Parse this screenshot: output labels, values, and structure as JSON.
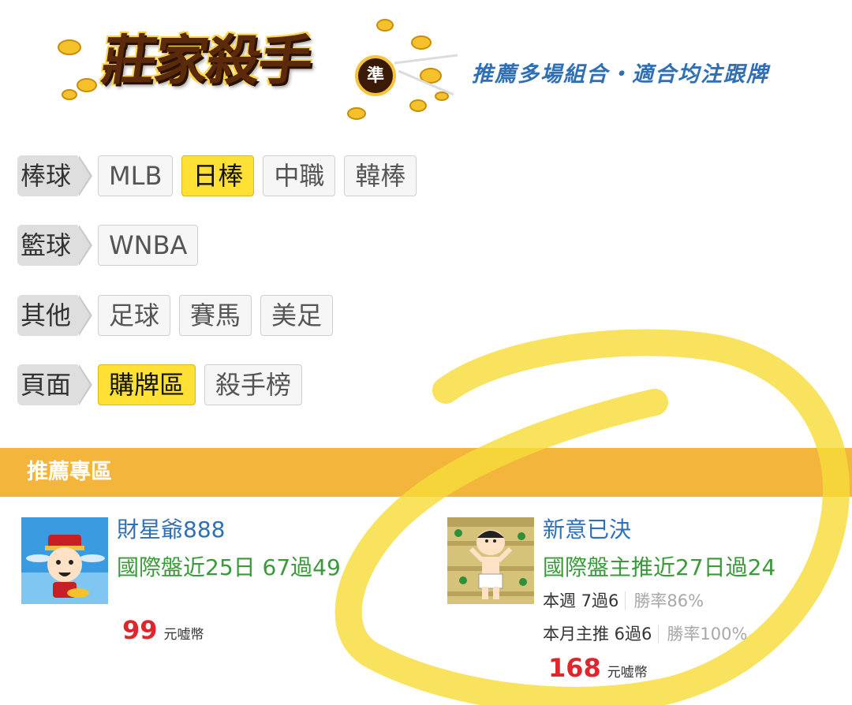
{
  "header": {
    "logo_text": "莊家殺手",
    "logo_badge": "準",
    "slogan": "推薦多場組合・適合均注跟牌"
  },
  "categories": [
    {
      "label": "棒球",
      "items": [
        {
          "label": "MLB",
          "active": false
        },
        {
          "label": "日棒",
          "active": true
        },
        {
          "label": "中職",
          "active": false
        },
        {
          "label": "韓棒",
          "active": false
        }
      ]
    },
    {
      "label": "籃球",
      "items": [
        {
          "label": "WNBA",
          "active": false
        }
      ]
    },
    {
      "label": "其他",
      "items": [
        {
          "label": "足球",
          "active": false
        },
        {
          "label": "賽馬",
          "active": false
        },
        {
          "label": "美足",
          "active": false
        }
      ]
    },
    {
      "label": "頁面",
      "items": [
        {
          "label": "購牌區",
          "active": true
        },
        {
          "label": "殺手榜",
          "active": false
        }
      ]
    }
  ],
  "section": {
    "title": "推薦專區"
  },
  "cards": [
    {
      "name": "財星爺888",
      "record": "國際盤近25日 67過49",
      "price": "99",
      "unit": "元嘘幣"
    },
    {
      "name": "新意已決",
      "record": "國際盤主推近27日過24",
      "week_label": "本週 7過6",
      "week_rate": "勝率86%",
      "month_label": "本月主推 6過6",
      "month_rate": "勝率100%",
      "price": "168",
      "unit": "元嘘幣"
    }
  ],
  "colors": {
    "accent_yellow": "#ffe034",
    "section_bar": "#f3b53c",
    "link_blue": "#2f6fb6",
    "record_green": "#3a9a3a",
    "price_red": "#e0262c"
  }
}
